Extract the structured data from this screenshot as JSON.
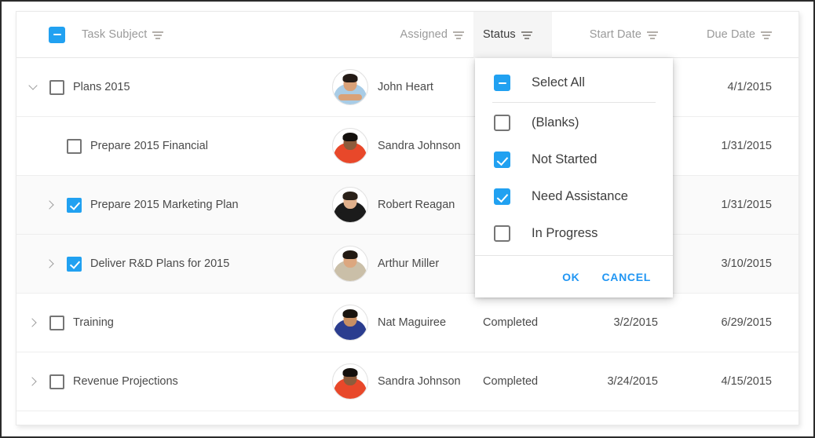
{
  "columns": {
    "task_subject": "Task Subject",
    "assigned": "Assigned",
    "status": "Status",
    "start_date": "Start Date",
    "due_date": "Due Date"
  },
  "header": {
    "select_all_state": "indeterminate"
  },
  "rows": [
    {
      "subject": "Plans 2015",
      "assigned": "John Heart",
      "status": "",
      "start_date": "",
      "due_date": "4/1/2015",
      "checked": false,
      "expander": "down",
      "level": 1,
      "selected": false,
      "avatar": {
        "skin": "#d9a178",
        "hair": "#241b16",
        "shirt": "#a8cce6",
        "arms": "#d9a178"
      }
    },
    {
      "subject": "Prepare 2015 Financial",
      "assigned": "Sandra Johnson",
      "status": "",
      "start_date": "",
      "due_date": "1/31/2015",
      "checked": false,
      "expander": "none",
      "level": 2,
      "selected": false,
      "avatar": {
        "skin": "#8d5c3c",
        "hair": "#14100d",
        "shirt": "#e8482a",
        "arms": "#e8482a"
      }
    },
    {
      "subject": "Prepare 2015 Marketing Plan",
      "assigned": "Robert Reagan",
      "status": "",
      "start_date": "",
      "due_date": "1/31/2015",
      "checked": true,
      "expander": "right",
      "level": 2,
      "selected": true,
      "avatar": {
        "skin": "#e0b08c",
        "hair": "#2a2119",
        "shirt": "#1b1b1b",
        "arms": "#1b1b1b"
      }
    },
    {
      "subject": "Deliver R&D Plans for 2015",
      "assigned": "Arthur Miller",
      "status": "",
      "start_date": "",
      "due_date": "3/10/2015",
      "checked": true,
      "expander": "right",
      "level": 2,
      "selected": true,
      "avatar": {
        "skin": "#dca77f",
        "hair": "#221a13",
        "shirt": "#cabfa8",
        "arms": "#cabfa8"
      }
    },
    {
      "subject": "Training",
      "assigned": "Nat Maguiree",
      "status": "Completed",
      "start_date": "3/2/2015",
      "due_date": "6/29/2015",
      "checked": false,
      "expander": "right",
      "level": 1,
      "selected": false,
      "avatar": {
        "skin": "#c98f63",
        "hair": "#19140f",
        "shirt": "#2b3d8f",
        "arms": "#2b3d8f"
      }
    },
    {
      "subject": "Revenue Projections",
      "assigned": "Sandra Johnson",
      "status": "Completed",
      "start_date": "3/24/2015",
      "due_date": "4/15/2015",
      "checked": false,
      "expander": "right",
      "level": 1,
      "selected": false,
      "avatar": {
        "skin": "#8d5c3c",
        "hair": "#14100d",
        "shirt": "#e8482a",
        "arms": "#e8482a"
      }
    }
  ],
  "filter_popup": {
    "select_all_label": "Select All",
    "select_all_state": "indeterminate",
    "options": [
      {
        "label": "(Blanks)",
        "checked": false
      },
      {
        "label": "Not Started",
        "checked": true
      },
      {
        "label": "Need Assistance",
        "checked": true
      },
      {
        "label": "In Progress",
        "checked": false
      }
    ],
    "ok_label": "OK",
    "cancel_label": "CANCEL"
  },
  "colors": {
    "accent": "#21a1f1",
    "link": "#2196f3",
    "selected_row": "#fafafa",
    "header_active": "#f5f5f5"
  }
}
